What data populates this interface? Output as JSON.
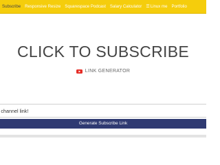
{
  "nav": {
    "items": [
      {
        "label": "Subscribe",
        "active": true
      },
      {
        "label": "Responsive Resize",
        "active": false
      },
      {
        "label": "Squarespace Podcast",
        "active": false
      },
      {
        "label": "Salary Calculator",
        "active": false
      },
      {
        "label": "Linux me",
        "active": false,
        "icon": "menu-icon"
      },
      {
        "label": "Portfolio",
        "active": false
      }
    ],
    "colors": {
      "background": "#f5cd0c",
      "text": "#ffffff",
      "active_text": "#444444"
    }
  },
  "hero": {
    "title": "CLICK TO SUBSCRIBE",
    "subtitle": "LINK GENERATOR",
    "subtitle_icon": "youtube-play-icon"
  },
  "form": {
    "placeholder": "our channel link!",
    "value": "",
    "button_label": "Generate Subscribe Link",
    "button_color": "#2f3a72"
  }
}
